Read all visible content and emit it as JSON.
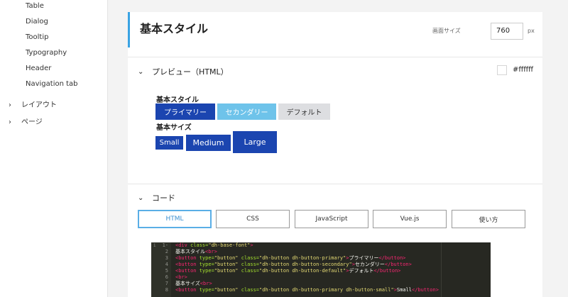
{
  "sidebar": {
    "sub_items": [
      "Table",
      "Dialog",
      "Tooltip",
      "Typography",
      "Header",
      "Navigation tab"
    ],
    "groups": [
      {
        "label": "レイアウト",
        "icon": "chevron-right-icon"
      },
      {
        "label": "ページ",
        "icon": "chevron-right-icon"
      }
    ]
  },
  "header": {
    "title": "基本スタイル",
    "screen_size_label": "画面サイズ",
    "screen_size_value": "760",
    "unit": "px"
  },
  "preview": {
    "toggle_label": "プレビュー（HTML）",
    "toggle_icon": "chevron-down-icon",
    "background_color": "#ffffff",
    "style_heading": "基本スタイル",
    "buttons": {
      "primary": "プライマリー",
      "secondary": "セカンダリー",
      "default": "デフォルト"
    },
    "size_heading": "基本サイズ",
    "sizes": {
      "small": "Small",
      "medium": "Medium",
      "large": "Large"
    }
  },
  "code_section": {
    "toggle_label": "コード",
    "toggle_icon": "chevron-down-icon",
    "tabs": [
      "HTML",
      "CSS",
      "JavaScript",
      "Vue.js",
      "使い方"
    ],
    "active_tab": "HTML",
    "editor": {
      "line_numbers": [
        "1",
        "2",
        "3",
        "4",
        "5",
        "6",
        "7",
        "8"
      ],
      "info_marker": "i",
      "fold_marker": "-",
      "lines": [
        [
          {
            "t": "tag",
            "v": "<div "
          },
          {
            "t": "attr",
            "v": "class="
          },
          {
            "t": "str",
            "v": "\"dh-base-font\""
          },
          {
            "t": "tag",
            "v": ">"
          }
        ],
        [
          {
            "t": "plain",
            "v": "基本スタイル"
          },
          {
            "t": "tag",
            "v": "<br>"
          }
        ],
        [
          {
            "t": "tag",
            "v": "<button "
          },
          {
            "t": "attr",
            "v": "type="
          },
          {
            "t": "str",
            "v": "\"button\""
          },
          {
            "t": "attr",
            "v": " class="
          },
          {
            "t": "str",
            "v": "\"dh-button dh-button-primary\""
          },
          {
            "t": "tag",
            "v": ">"
          },
          {
            "t": "plain",
            "v": "プライマリー"
          },
          {
            "t": "tag",
            "v": "</button>"
          }
        ],
        [
          {
            "t": "tag",
            "v": "<button "
          },
          {
            "t": "attr",
            "v": "type="
          },
          {
            "t": "str",
            "v": "\"button\""
          },
          {
            "t": "attr",
            "v": " class="
          },
          {
            "t": "str",
            "v": "\"dh-button dh-button-secondary\""
          },
          {
            "t": "tag",
            "v": ">"
          },
          {
            "t": "plain",
            "v": "セカンダリー"
          },
          {
            "t": "tag",
            "v": "</button>"
          }
        ],
        [
          {
            "t": "tag",
            "v": "<button "
          },
          {
            "t": "attr",
            "v": "type="
          },
          {
            "t": "str",
            "v": "\"button\""
          },
          {
            "t": "attr",
            "v": " class="
          },
          {
            "t": "str",
            "v": "\"dh-button dh-button-default\""
          },
          {
            "t": "tag",
            "v": ">"
          },
          {
            "t": "plain",
            "v": "デフォルト"
          },
          {
            "t": "tag",
            "v": "</button>"
          }
        ],
        [
          {
            "t": "tag",
            "v": "<br>"
          }
        ],
        [
          {
            "t": "plain",
            "v": "基本サイズ"
          },
          {
            "t": "tag",
            "v": "<br>"
          }
        ],
        [
          {
            "t": "tag",
            "v": "<button "
          },
          {
            "t": "attr",
            "v": "type="
          },
          {
            "t": "str",
            "v": "\"button\""
          },
          {
            "t": "attr",
            "v": " class="
          },
          {
            "t": "str",
            "v": "\"dh-button dh-button-primary dh-button-small\""
          },
          {
            "t": "tag",
            "v": ">"
          },
          {
            "t": "plain",
            "v": "Small"
          },
          {
            "t": "tag",
            "v": "</button>"
          }
        ]
      ]
    }
  },
  "colors": {
    "accent_bar": "#3aa3e3",
    "primary": "#1b45b0",
    "secondary": "#6ec3ea",
    "default": "#dddee1",
    "editor_bg": "#272822"
  }
}
